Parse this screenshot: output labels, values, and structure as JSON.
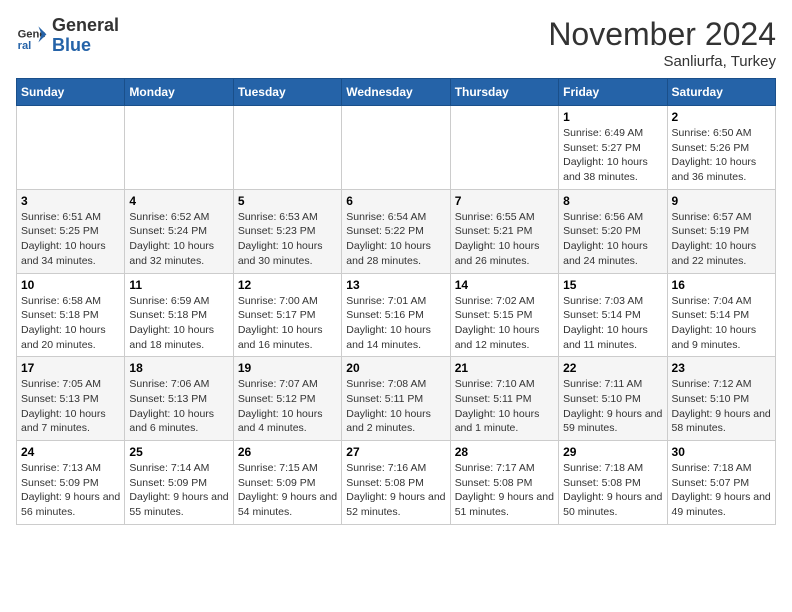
{
  "header": {
    "logo_general": "General",
    "logo_blue": "Blue",
    "month_title": "November 2024",
    "subtitle": "Sanliurfa, Turkey"
  },
  "days_of_week": [
    "Sunday",
    "Monday",
    "Tuesday",
    "Wednesday",
    "Thursday",
    "Friday",
    "Saturday"
  ],
  "weeks": [
    [
      {
        "day": "",
        "info": ""
      },
      {
        "day": "",
        "info": ""
      },
      {
        "day": "",
        "info": ""
      },
      {
        "day": "",
        "info": ""
      },
      {
        "day": "",
        "info": ""
      },
      {
        "day": "1",
        "info": "Sunrise: 6:49 AM\nSunset: 5:27 PM\nDaylight: 10 hours and 38 minutes."
      },
      {
        "day": "2",
        "info": "Sunrise: 6:50 AM\nSunset: 5:26 PM\nDaylight: 10 hours and 36 minutes."
      }
    ],
    [
      {
        "day": "3",
        "info": "Sunrise: 6:51 AM\nSunset: 5:25 PM\nDaylight: 10 hours and 34 minutes."
      },
      {
        "day": "4",
        "info": "Sunrise: 6:52 AM\nSunset: 5:24 PM\nDaylight: 10 hours and 32 minutes."
      },
      {
        "day": "5",
        "info": "Sunrise: 6:53 AM\nSunset: 5:23 PM\nDaylight: 10 hours and 30 minutes."
      },
      {
        "day": "6",
        "info": "Sunrise: 6:54 AM\nSunset: 5:22 PM\nDaylight: 10 hours and 28 minutes."
      },
      {
        "day": "7",
        "info": "Sunrise: 6:55 AM\nSunset: 5:21 PM\nDaylight: 10 hours and 26 minutes."
      },
      {
        "day": "8",
        "info": "Sunrise: 6:56 AM\nSunset: 5:20 PM\nDaylight: 10 hours and 24 minutes."
      },
      {
        "day": "9",
        "info": "Sunrise: 6:57 AM\nSunset: 5:19 PM\nDaylight: 10 hours and 22 minutes."
      }
    ],
    [
      {
        "day": "10",
        "info": "Sunrise: 6:58 AM\nSunset: 5:18 PM\nDaylight: 10 hours and 20 minutes."
      },
      {
        "day": "11",
        "info": "Sunrise: 6:59 AM\nSunset: 5:18 PM\nDaylight: 10 hours and 18 minutes."
      },
      {
        "day": "12",
        "info": "Sunrise: 7:00 AM\nSunset: 5:17 PM\nDaylight: 10 hours and 16 minutes."
      },
      {
        "day": "13",
        "info": "Sunrise: 7:01 AM\nSunset: 5:16 PM\nDaylight: 10 hours and 14 minutes."
      },
      {
        "day": "14",
        "info": "Sunrise: 7:02 AM\nSunset: 5:15 PM\nDaylight: 10 hours and 12 minutes."
      },
      {
        "day": "15",
        "info": "Sunrise: 7:03 AM\nSunset: 5:14 PM\nDaylight: 10 hours and 11 minutes."
      },
      {
        "day": "16",
        "info": "Sunrise: 7:04 AM\nSunset: 5:14 PM\nDaylight: 10 hours and 9 minutes."
      }
    ],
    [
      {
        "day": "17",
        "info": "Sunrise: 7:05 AM\nSunset: 5:13 PM\nDaylight: 10 hours and 7 minutes."
      },
      {
        "day": "18",
        "info": "Sunrise: 7:06 AM\nSunset: 5:13 PM\nDaylight: 10 hours and 6 minutes."
      },
      {
        "day": "19",
        "info": "Sunrise: 7:07 AM\nSunset: 5:12 PM\nDaylight: 10 hours and 4 minutes."
      },
      {
        "day": "20",
        "info": "Sunrise: 7:08 AM\nSunset: 5:11 PM\nDaylight: 10 hours and 2 minutes."
      },
      {
        "day": "21",
        "info": "Sunrise: 7:10 AM\nSunset: 5:11 PM\nDaylight: 10 hours and 1 minute."
      },
      {
        "day": "22",
        "info": "Sunrise: 7:11 AM\nSunset: 5:10 PM\nDaylight: 9 hours and 59 minutes."
      },
      {
        "day": "23",
        "info": "Sunrise: 7:12 AM\nSunset: 5:10 PM\nDaylight: 9 hours and 58 minutes."
      }
    ],
    [
      {
        "day": "24",
        "info": "Sunrise: 7:13 AM\nSunset: 5:09 PM\nDaylight: 9 hours and 56 minutes."
      },
      {
        "day": "25",
        "info": "Sunrise: 7:14 AM\nSunset: 5:09 PM\nDaylight: 9 hours and 55 minutes."
      },
      {
        "day": "26",
        "info": "Sunrise: 7:15 AM\nSunset: 5:09 PM\nDaylight: 9 hours and 54 minutes."
      },
      {
        "day": "27",
        "info": "Sunrise: 7:16 AM\nSunset: 5:08 PM\nDaylight: 9 hours and 52 minutes."
      },
      {
        "day": "28",
        "info": "Sunrise: 7:17 AM\nSunset: 5:08 PM\nDaylight: 9 hours and 51 minutes."
      },
      {
        "day": "29",
        "info": "Sunrise: 7:18 AM\nSunset: 5:08 PM\nDaylight: 9 hours and 50 minutes."
      },
      {
        "day": "30",
        "info": "Sunrise: 7:18 AM\nSunset: 5:07 PM\nDaylight: 9 hours and 49 minutes."
      }
    ]
  ]
}
